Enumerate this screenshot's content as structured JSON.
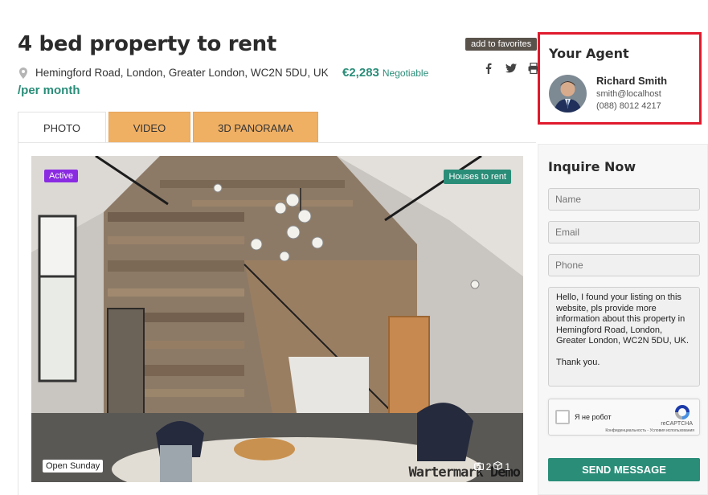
{
  "listing": {
    "title": "4 bed property to rent",
    "favorites_label": "add to favorites",
    "address": "Hemingford Road, London, Greater London, WC2N 5DU, UK",
    "price": "€2,283",
    "price_note": "Negotiable",
    "period": "/per month",
    "share_icons": [
      "facebook-icon",
      "twitter-icon",
      "print-icon"
    ]
  },
  "tabs": [
    {
      "label": "PHOTO",
      "active": true
    },
    {
      "label": "VIDEO",
      "active": false
    },
    {
      "label": "3D PANORAMA",
      "active": false
    }
  ],
  "photo": {
    "status_badge": "Active",
    "category_badge": "Houses to rent",
    "open_badge": "Open Sunday",
    "photo_count": "2",
    "panorama_count": "1",
    "watermark": "Wartermark Demo"
  },
  "agent": {
    "heading": "Your Agent",
    "name": "Richard Smith",
    "email": "smith@localhost",
    "phone": "(088) 8012 4217"
  },
  "inquiry": {
    "title": "Inquire Now",
    "name_placeholder": "Name",
    "email_placeholder": "Email",
    "phone_placeholder": "Phone",
    "message": "Hello, I found your listing on this website, pls provide more information about this property in Hemingford Road, London, Greater London, WC2N 5DU, UK.\n\nThank you.",
    "captcha_label": "Я не робот",
    "captcha_brand": "reCAPTCHA",
    "captcha_links": "Конфиденциальность - Условия использования",
    "submit_label": "SEND MESSAGE"
  },
  "colors": {
    "accent": "#2a8d78",
    "tab_orange": "#f0b064",
    "active_badge": "#8a2be2",
    "highlight_border": "#e0192d"
  }
}
